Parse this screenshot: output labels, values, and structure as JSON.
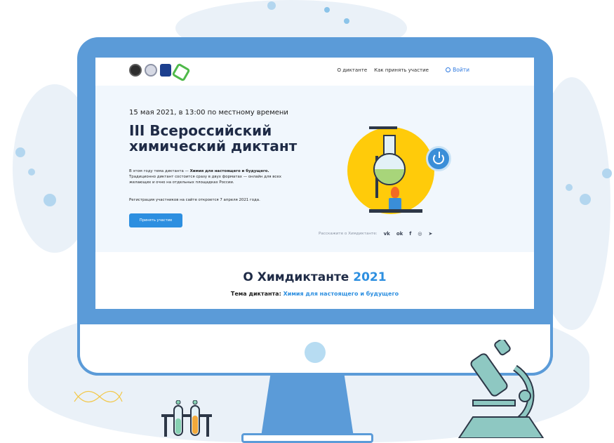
{
  "nav": {
    "links": [
      "О диктанте",
      "Как принять участие"
    ],
    "login_label": "Войти"
  },
  "hero": {
    "date": "15 мая 2021, в 13:00 по местному времени",
    "title": "III Всероссийский химический диктант",
    "desc_intro": "В этом году тема диктанта — ",
    "desc_topic": "Химия для настоящего и будущего.",
    "desc_rest": " Традиционно диктант состоится сразу в двух форматах — онлайн для всех желающих и очно на отдельных площадках России.",
    "registration": "Регистрация участников на сайте откроется 7 апреля 2021 года.",
    "button_label": "Принять участие",
    "share_label": "Расскажите о Химдиктанте:"
  },
  "about": {
    "title_text": "О Химдиктанте ",
    "title_year": "2021",
    "subtitle_label": "Тема диктанта: ",
    "subtitle_topic": "Химия для настоящего и будущего"
  },
  "colors": {
    "accent": "#2d8fe0",
    "monitor": "#5b9bd8",
    "sun": "#ffcb0a"
  },
  "icons": [
    "vk-icon",
    "odnoklassniki-icon",
    "facebook-icon",
    "whatsapp-icon",
    "telegram-icon",
    "user-icon",
    "power-icon"
  ]
}
